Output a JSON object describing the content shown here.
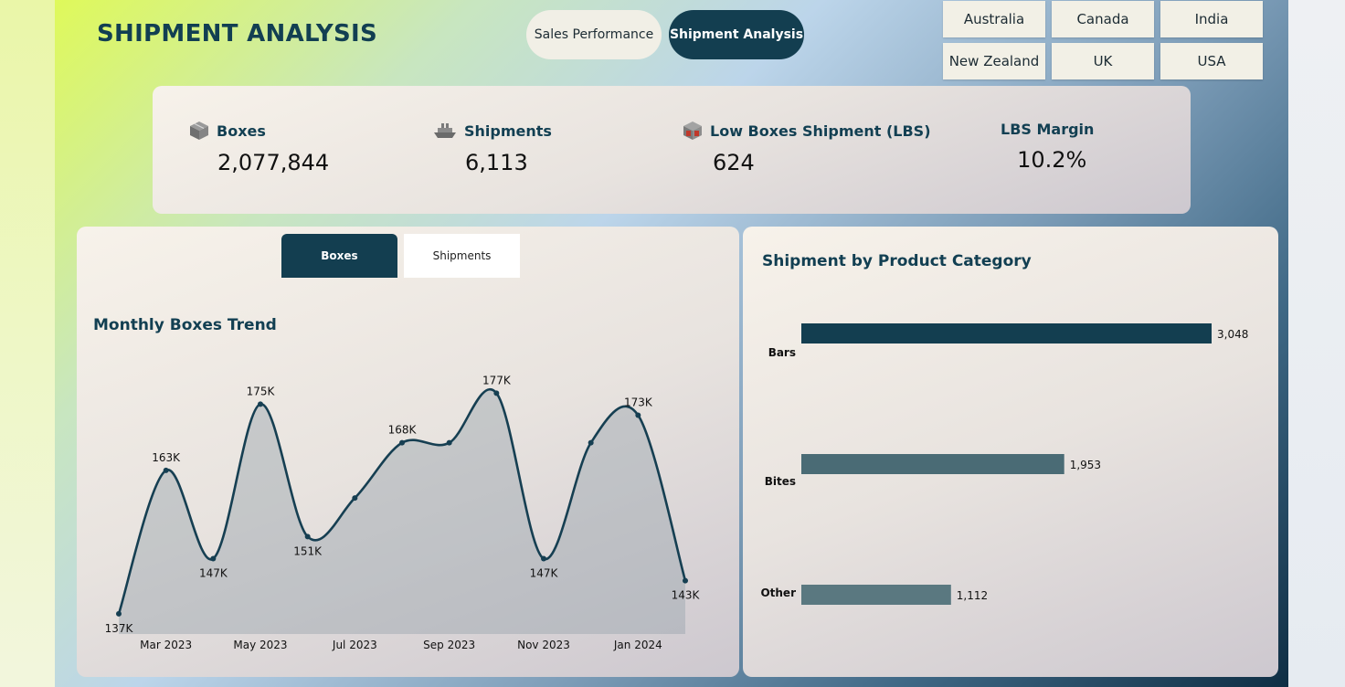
{
  "header": {
    "title": "SHIPMENT ANALYSIS",
    "tabs": [
      {
        "label": "Sales Performance",
        "active": false
      },
      {
        "label": "Shipment Analysis",
        "active": true
      }
    ]
  },
  "countries": [
    "Australia",
    "Canada",
    "India",
    "New Zealand",
    "UK",
    "USA"
  ],
  "kpis": [
    {
      "label": "Boxes",
      "value": "2,077,844",
      "icon": "box-icon"
    },
    {
      "label": "Shipments",
      "value": "6,113",
      "icon": "ship-icon"
    },
    {
      "label": "Low Boxes Shipment (LBS)",
      "value": "624",
      "icon": "box-alert-icon"
    },
    {
      "label": "LBS Margin",
      "value": "10.2%",
      "icon": ""
    }
  ],
  "trend_card": {
    "toggle": [
      {
        "label": "Boxes",
        "active": true
      },
      {
        "label": "Shipments",
        "active": false
      }
    ],
    "title": "Monthly Boxes Trend"
  },
  "category_card": {
    "title": "Shipment by Product Category"
  },
  "colors": {
    "dark_teal": "#133e50",
    "line": "#163f52",
    "bar_1": "#133e50",
    "bar_2": "#4a6b75",
    "bar_3": "#5a7880"
  },
  "chart_data": [
    {
      "type": "area",
      "title": "Monthly Boxes Trend",
      "x": [
        "Feb 2023",
        "Mar 2023",
        "Apr 2023",
        "May 2023",
        "Jun 2023",
        "Jul 2023",
        "Aug 2023",
        "Sep 2023",
        "Oct 2023",
        "Nov 2023",
        "Dec 2023",
        "Jan 2024",
        "Feb 2024"
      ],
      "values": [
        137,
        163,
        147,
        175,
        151,
        158,
        168,
        168,
        177,
        147,
        168,
        173,
        143
      ],
      "data_labels": [
        "137K",
        "163K",
        "147K",
        "175K",
        "151K",
        "",
        "168K",
        "",
        "177K",
        "147K",
        "",
        "173K",
        "143K"
      ],
      "tick_labels": [
        "Mar 2023",
        "May 2023",
        "Jul 2023",
        "Sep 2023",
        "Nov 2023",
        "Jan 2024"
      ],
      "ylim": [
        135,
        185
      ],
      "units": "thousands",
      "grid": false
    },
    {
      "type": "bar",
      "orientation": "horizontal",
      "title": "Shipment by Product Category",
      "categories": [
        "Bars",
        "Bites",
        "Other"
      ],
      "values": [
        3048,
        1953,
        1112
      ],
      "value_labels": [
        "3,048",
        "1,953",
        "1,112"
      ]
    }
  ]
}
